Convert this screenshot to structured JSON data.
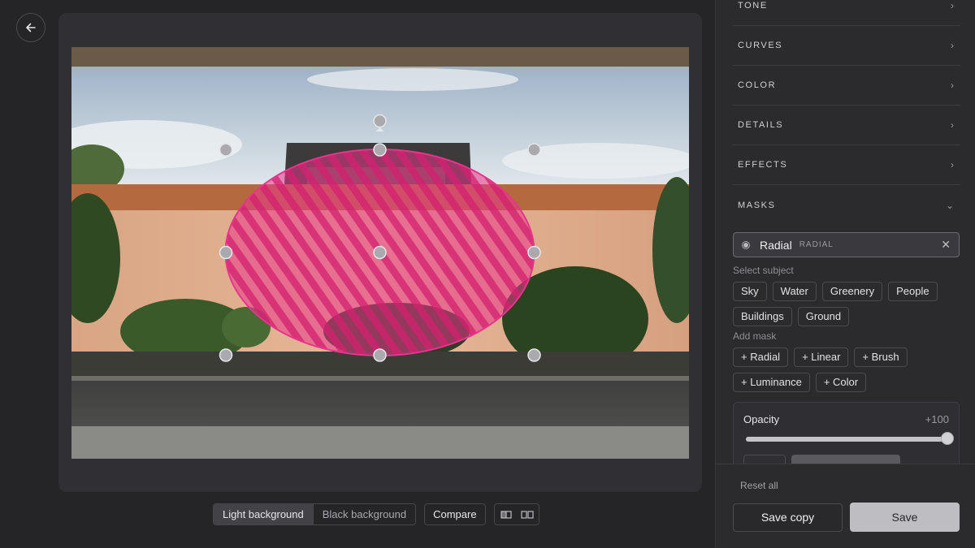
{
  "editor": {
    "back_icon": "arrow-left-icon",
    "mask_overlay_color": "#e8348c",
    "handle_color": "#a9a9ae"
  },
  "bottom_bar": {
    "light_background": "Light background",
    "black_background": "Black background",
    "active_background": "Light background",
    "compare": "Compare",
    "view_icons": [
      "split-view-icon",
      "side-by-side-icon"
    ]
  },
  "sidebar": {
    "sections": [
      {
        "label": "TONE",
        "expanded": false
      },
      {
        "label": "CURVES",
        "expanded": false
      },
      {
        "label": "COLOR",
        "expanded": false
      },
      {
        "label": "DETAILS",
        "expanded": false
      },
      {
        "label": "EFFECTS",
        "expanded": false
      },
      {
        "label": "MASKS",
        "expanded": true
      }
    ],
    "masks": {
      "active_mask": {
        "name": "Radial",
        "type": "RADIAL"
      },
      "select_subject_label": "Select subject",
      "subjects": [
        "Sky",
        "Water",
        "Greenery",
        "People",
        "Buildings",
        "Ground"
      ],
      "add_mask_label": "Add mask",
      "add_mask_options": [
        "+ Radial",
        "+ Linear",
        "+ Brush",
        "+ Luminance",
        "+ Color"
      ],
      "opacity": {
        "label": "Opacity",
        "value_text": "+100",
        "value": 100,
        "min": 0,
        "max": 100
      }
    },
    "reset_all": "Reset all",
    "save_copy": "Save copy",
    "save": "Save"
  }
}
